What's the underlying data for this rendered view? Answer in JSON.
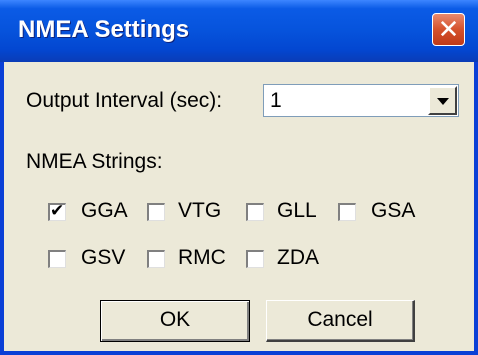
{
  "window": {
    "title": "NMEA Settings",
    "close_glyph": "✕"
  },
  "output_interval": {
    "label": "Output Interval (sec):",
    "value": "1"
  },
  "nmea_strings": {
    "label": "NMEA Strings:",
    "items": [
      {
        "label": "GGA",
        "checked": true
      },
      {
        "label": "VTG",
        "checked": false
      },
      {
        "label": "GLL",
        "checked": false
      },
      {
        "label": "GSA",
        "checked": false
      },
      {
        "label": "GSV",
        "checked": false
      },
      {
        "label": "RMC",
        "checked": false
      },
      {
        "label": "ZDA",
        "checked": false
      }
    ]
  },
  "buttons": {
    "ok": "OK",
    "cancel": "Cancel"
  }
}
